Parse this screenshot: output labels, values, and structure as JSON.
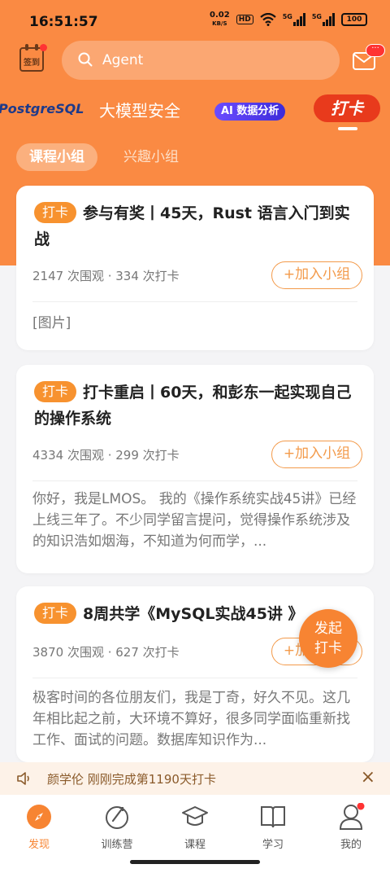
{
  "status": {
    "time": "16:51:57",
    "net_speed": "0.02",
    "net_unit": "KB/S",
    "hd": "HD",
    "wifi": "wifi-icon",
    "sig1": "5G",
    "sig2": "5G",
    "battery": "100"
  },
  "header": {
    "signin_label": "签到",
    "search_placeholder": "Agent"
  },
  "tabs": [
    {
      "label": "PostgreSQL"
    },
    {
      "label": "大模型安全"
    },
    {
      "label": "AI 数据分析"
    },
    {
      "label": "打卡"
    }
  ],
  "subtabs": {
    "active": "课程小组",
    "other": "兴趣小组"
  },
  "cards": [
    {
      "badge": "打卡",
      "title": "参与有奖丨45天，Rust 语言入门到实战",
      "stats": "2147 次围观 · 334 次打卡",
      "join": "+加入小组",
      "body": "[图片]"
    },
    {
      "badge": "打卡",
      "title": "打卡重启丨60天，和彭东一起实现自己的操作系统",
      "stats": "4334 次围观 · 299 次打卡",
      "join": "+加入小组",
      "body": "你好，我是LMOS。 我的《操作系统实战45讲》已经上线三年了。不少同学留言提问，觉得操作系统涉及的知识浩如烟海，不知道为何而学，..."
    },
    {
      "badge": "打卡",
      "title": "8周共学《MySQL实战45讲 》",
      "stats": "3870 次围观 · 627 次打卡",
      "join": "+加入小组",
      "body": "极客时间的各位朋友们，我是丁奇，好久不见。这几年相比起之前，大环境不算好，很多同学面临重新找工作、面试的问题。数据库知识作为..."
    }
  ],
  "fab": {
    "line1": "发起",
    "line2": "打卡"
  },
  "notice": {
    "text": "颜学伦 刚刚完成第1190天打卡",
    "close": "×"
  },
  "nav": [
    {
      "label": "发现",
      "icon": "compass-icon"
    },
    {
      "label": "训练营",
      "icon": "training-icon"
    },
    {
      "label": "课程",
      "icon": "graduation-cap-icon"
    },
    {
      "label": "学习",
      "icon": "book-icon"
    },
    {
      "label": "我的",
      "icon": "profile-icon"
    }
  ],
  "colors": {
    "accent": "#fa8a43",
    "badge": "#f7922f",
    "active_tab": "#e83a1c"
  }
}
